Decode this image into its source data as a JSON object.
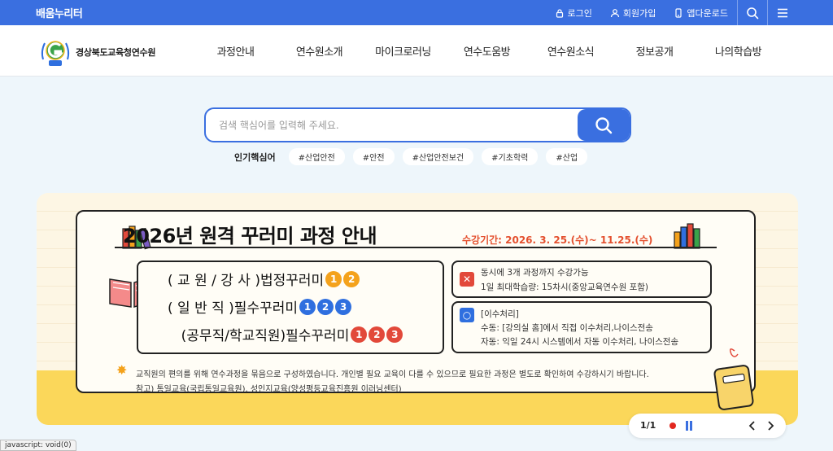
{
  "topbar": {
    "logo": "배움누리터",
    "links": [
      {
        "label": "로그인",
        "icon": "lock-icon"
      },
      {
        "label": "회원가입",
        "icon": "user-icon"
      },
      {
        "label": "앱다운로드",
        "icon": "phone-icon"
      }
    ],
    "accent": "#3a6fe0"
  },
  "header": {
    "org_name": "경상북도교육청연수원",
    "nav": [
      "과정안내",
      "연수원소개",
      "마이크로러닝",
      "연수도움방",
      "연수원소식",
      "정보공개",
      "나의학습방"
    ]
  },
  "search": {
    "placeholder": "검색 핵심어를 입력해 주세요.",
    "keywords_label": "인기핵심어",
    "keywords": [
      "#산업안전",
      "#안전",
      "#산업안전보건",
      "#기초학력",
      "#산업"
    ]
  },
  "banner": {
    "title": "2026년 원격 꾸러미 과정 안내",
    "period": "수강기간: 2026. 3. 25.(수)~ 11.25.(수)",
    "courses": [
      {
        "text": "( 교 원 / 강 사 )법정꾸러미",
        "nums": [
          "1",
          "2"
        ],
        "color": "o"
      },
      {
        "text": "(   일   반   직   )필수꾸러미",
        "nums": [
          "1",
          "2",
          "3"
        ],
        "color": "b"
      },
      {
        "text": "(공무직/학교직원)필수꾸러미",
        "nums": [
          "1",
          "2",
          "3"
        ],
        "color": "r"
      }
    ],
    "info1": {
      "line1": "동시에 3개 과정까지 수강가능",
      "line2": "1일 최대학습량: 15차시(중앙교육연수원 포함)"
    },
    "info2": {
      "title": "[이수처리]",
      "line1": "수동: [강의실 홈]에서 직접 이수처리,나이스전송",
      "line2": "자동: 익일 24시 시스템에서 자동 이수처리, 나이스전송"
    },
    "note1": "교직원의 편의를 위해 연수과정을 묶음으로 구성하였습니다. 개인별 필요 교육이 다를 수 있으므로 필요한 과정은 별도로 확인하여 수강하시기 바랍니다.",
    "note2": "참고) 통일교육(국립통일교육원), 성인지교육(양성평등교육진흥원 이러닝센터)"
  },
  "pager": {
    "count": "1/1"
  },
  "status": "javascript: void(0)"
}
